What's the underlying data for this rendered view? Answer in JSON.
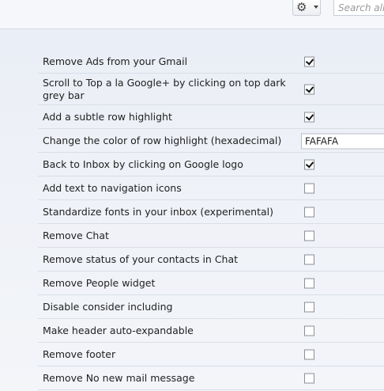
{
  "toolbar": {
    "gear_glyph": "⚙",
    "search_placeholder": "Search all co"
  },
  "settings": [
    {
      "label": "Remove Ads from your Gmail",
      "checked": true
    },
    {
      "label": "Scroll to Top a la Google+ by clicking on top dark grey bar",
      "checked": true
    },
    {
      "label": "Add a subtle row highlight",
      "checked": true
    },
    {
      "label": "Change the color of row highlight (hexadecimal)",
      "value": "FAFAFA"
    },
    {
      "label": "Back to Inbox by clicking on Google logo",
      "checked": true
    },
    {
      "label": "Add text to navigation icons",
      "checked": false
    },
    {
      "label": "Standardize fonts in your inbox (experimental)",
      "checked": false
    },
    {
      "label": "Remove Chat",
      "checked": false
    },
    {
      "label": "Remove status of your contacts in Chat",
      "checked": false
    },
    {
      "label": "Remove People widget",
      "checked": false
    },
    {
      "label": "Disable consider including",
      "checked": false
    },
    {
      "label": "Make header auto-expandable",
      "checked": false
    },
    {
      "label": "Remove footer",
      "checked": false
    },
    {
      "label": "Remove No new mail message",
      "checked": false
    }
  ]
}
